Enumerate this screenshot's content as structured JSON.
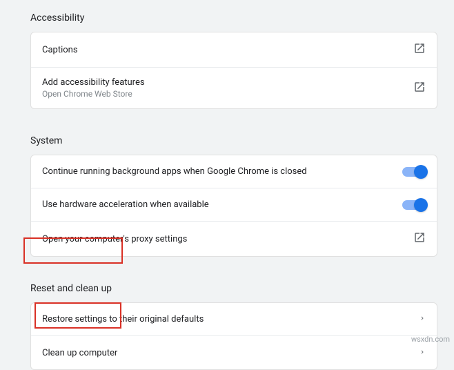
{
  "accessibility": {
    "title": "Accessibility",
    "rows": {
      "captions": {
        "label": "Captions"
      },
      "addFeatures": {
        "label": "Add accessibility features",
        "sub": "Open Chrome Web Store"
      }
    }
  },
  "system": {
    "title": "System",
    "rows": {
      "backgroundApps": {
        "label": "Continue running background apps when Google Chrome is closed",
        "toggle": true
      },
      "hwAccel": {
        "label": "Use hardware acceleration when available",
        "toggle": true
      },
      "proxy": {
        "label": "Open your computer's proxy settings"
      }
    }
  },
  "reset": {
    "title": "Reset and clean up",
    "rows": {
      "restore": {
        "label": "Restore settings to their original defaults"
      },
      "cleanup": {
        "label": "Clean up computer"
      }
    }
  },
  "watermark": "wsxdn.com"
}
